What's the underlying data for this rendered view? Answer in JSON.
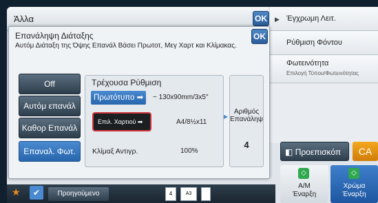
{
  "topbar": {
    "title": "Άλλα",
    "ok": "OK"
  },
  "rightpanel": {
    "items": [
      {
        "label": "Έγχρωμη Λειτ."
      },
      {
        "label": "Ρύθμιση Φόντου"
      },
      {
        "label": "Φωτεινότητα",
        "sub": "Επιλογή Τύπου/Φωτεινότητας"
      }
    ]
  },
  "dialog": {
    "title": "Επανάληψη Διάταξης",
    "subtitle": "Αυτόμ Διάταξη της Όψης Επανάλ Βάσει Πρωτοτ, Μεγ Χαρτ και Κλίμακας.",
    "ok": "OK",
    "side_buttons": [
      {
        "label": "Off"
      },
      {
        "label": "Αυτόμ επανάλ"
      },
      {
        "label": "Καθορ Επανάλ"
      },
      {
        "label": "Επαναλ. Φωτ."
      }
    ],
    "current": {
      "title": "Τρέχουσα Ρύθμιση",
      "original_label": "Πρωτότυπο",
      "original_value": "130x90mm/3x5\"",
      "original_prefix": "~",
      "paper_label": "Επιλ. Χαρτιού",
      "paper_value": "A4/8½x11",
      "ratio_label": "Κλίμαξ Αντιγρ.",
      "ratio_value": "100%"
    },
    "count": {
      "label_1": "Αριθμός",
      "label_2": "Επανάληψ",
      "value": "4"
    }
  },
  "bottom": {
    "preview": "Προεπισκόπ",
    "ca": "CA",
    "start_bw": {
      "label_1": "Α/Μ",
      "label_2": "Έναρξη"
    },
    "start_color": {
      "label_1": "Χρώμα",
      "label_2": "Έναρξη"
    },
    "previous": "Προηγούμενο",
    "thumbs": {
      "a": "4",
      "b": "A3"
    }
  },
  "colors": {
    "accent": "#2766ad",
    "ca": "#e8941a",
    "highlight": "#d0353a"
  }
}
